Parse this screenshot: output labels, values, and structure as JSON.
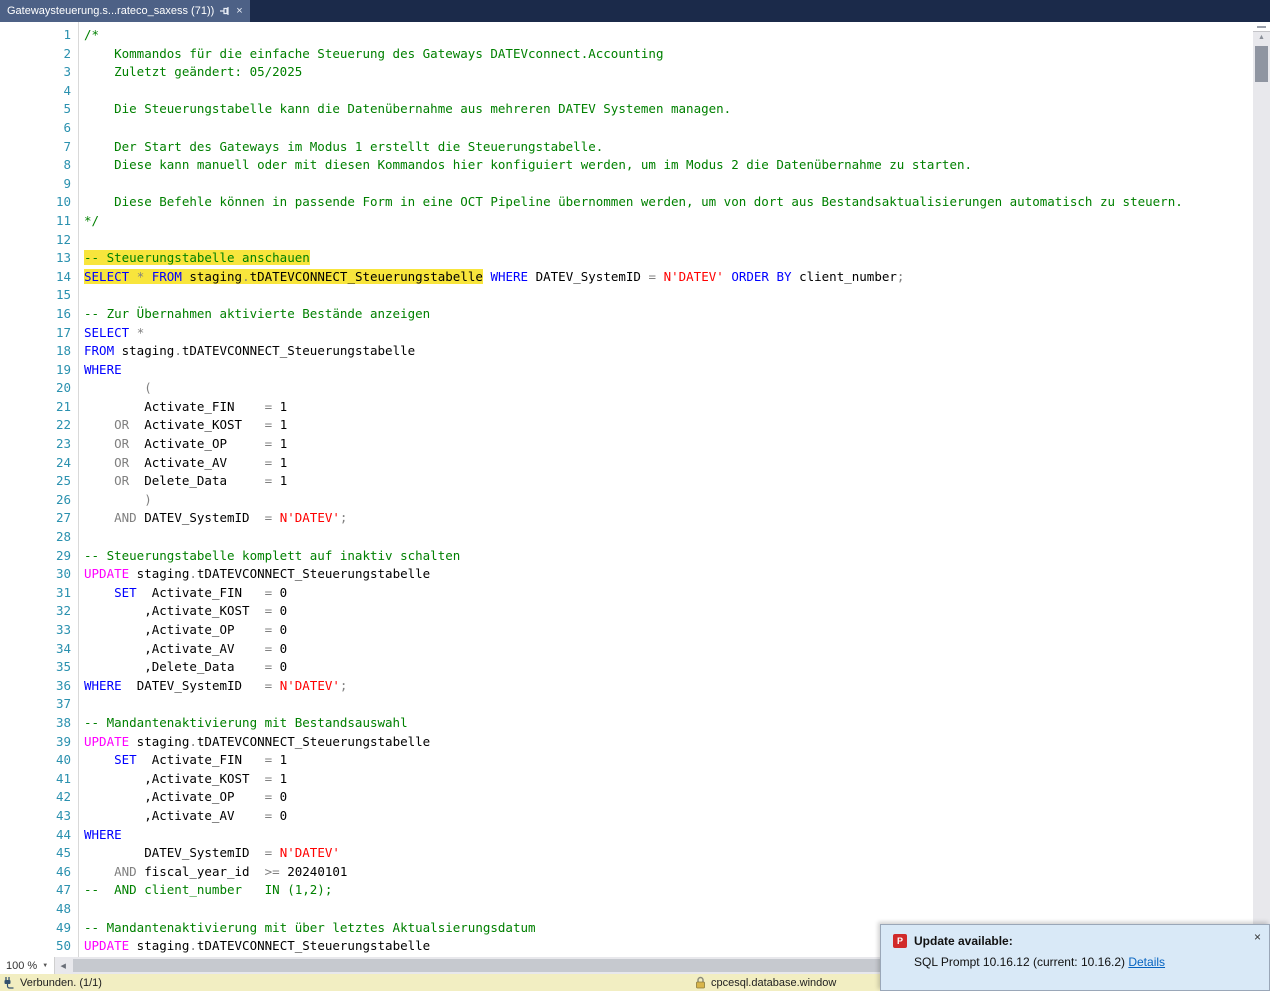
{
  "tab": {
    "title": "Gatewaysteuerung.s...rateco_saxess (71))"
  },
  "zoom": {
    "value": "100 %"
  },
  "status": {
    "connection": "Verbunden. (1/1)",
    "server": "cpcesql.database.window"
  },
  "notification": {
    "title": "Update available:",
    "message": "SQL Prompt 10.16.12 (current: 10.16.2) ",
    "link": "Details",
    "close": "×",
    "icon_label": "P"
  },
  "colors": {
    "kw": "#0000ff",
    "cm": "#008000",
    "st": "#ff0000",
    "op": "#808080",
    "mg": "#ff00ff",
    "tx": "#000000",
    "lnc": "#2b91af",
    "hl": "#f8e53c",
    "tabbg": "#1b2a4a",
    "tabactive": "#4d6186",
    "statusbg": "#f2eec2",
    "notifbg": "#d9e9f7",
    "link": "#0563c1"
  },
  "editor": {
    "lines": [
      {
        "n": 1,
        "tk": [
          [
            "c",
            "/*"
          ]
        ]
      },
      {
        "n": 2,
        "tk": [
          [
            "c",
            "    Kommandos für die einfache Steuerung des Gateways DATEVconnect.Accounting"
          ]
        ]
      },
      {
        "n": 3,
        "tk": [
          [
            "c",
            "    Zuletzt geändert: 05/2025"
          ]
        ]
      },
      {
        "n": 4,
        "tk": []
      },
      {
        "n": 5,
        "tk": [
          [
            "c",
            "    Die Steuerungstabelle kann die Datenübernahme aus mehreren DATEV Systemen managen."
          ]
        ]
      },
      {
        "n": 6,
        "tk": []
      },
      {
        "n": 7,
        "tk": [
          [
            "c",
            "    Der Start des Gateways im Modus 1 erstellt die Steuerungstabelle."
          ]
        ]
      },
      {
        "n": 8,
        "tk": [
          [
            "c",
            "    Diese kann manuell oder mit diesen Kommandos hier konfiguiert werden, um im Modus 2 die Datenübernahme zu starten."
          ]
        ]
      },
      {
        "n": 9,
        "tk": []
      },
      {
        "n": 10,
        "tk": [
          [
            "c",
            "    Diese Befehle können in passende Form in eine OCT Pipeline übernommen werden, um von dort aus Bestandsaktualisierungen automatisch zu steuern."
          ]
        ]
      },
      {
        "n": 11,
        "tk": [
          [
            "c",
            "*/"
          ]
        ]
      },
      {
        "n": 12,
        "tk": []
      },
      {
        "n": 13,
        "tk": [
          [
            "c",
            "-- Steuerungstabelle anschauen",
            1
          ]
        ]
      },
      {
        "n": 14,
        "tk": [
          [
            "k",
            "SELECT",
            1
          ],
          [
            "t",
            " ",
            1
          ],
          [
            "o",
            "*",
            1
          ],
          [
            "t",
            " ",
            1
          ],
          [
            "k",
            "FROM",
            1
          ],
          [
            "t",
            " staging",
            1
          ],
          [
            "o",
            ".",
            1
          ],
          [
            "t",
            "tDATEVCONNECT_Steuerungstabelle",
            1
          ],
          [
            "t",
            " "
          ],
          [
            "k",
            "WHERE"
          ],
          [
            "t",
            " DATEV_SystemID "
          ],
          [
            "o",
            "="
          ],
          [
            "t",
            " "
          ],
          [
            "s",
            "N'DATEV'"
          ],
          [
            "t",
            " "
          ],
          [
            "k",
            "ORDER"
          ],
          [
            "t",
            " "
          ],
          [
            "k",
            "BY"
          ],
          [
            "t",
            " client_number"
          ],
          [
            "o",
            ";"
          ]
        ]
      },
      {
        "n": 15,
        "tk": []
      },
      {
        "n": 16,
        "tk": [
          [
            "c",
            "-- Zur Übernahmen aktivierte Bestände anzeigen"
          ]
        ]
      },
      {
        "n": 17,
        "tk": [
          [
            "k",
            "SELECT"
          ],
          [
            "t",
            " "
          ],
          [
            "o",
            "*"
          ]
        ]
      },
      {
        "n": 18,
        "tk": [
          [
            "k",
            "FROM"
          ],
          [
            "t",
            " staging"
          ],
          [
            "o",
            "."
          ],
          [
            "t",
            "tDATEVCONNECT_Steuerungstabelle"
          ]
        ]
      },
      {
        "n": 19,
        "tk": [
          [
            "k",
            "WHERE"
          ]
        ]
      },
      {
        "n": 20,
        "tk": [
          [
            "t",
            "        "
          ],
          [
            "o",
            "("
          ]
        ]
      },
      {
        "n": 21,
        "tk": [
          [
            "t",
            "        Activate_FIN    "
          ],
          [
            "o",
            "="
          ],
          [
            "t",
            " 1"
          ]
        ]
      },
      {
        "n": 22,
        "tk": [
          [
            "t",
            "    "
          ],
          [
            "o",
            "OR"
          ],
          [
            "t",
            "  Activate_KOST   "
          ],
          [
            "o",
            "="
          ],
          [
            "t",
            " 1"
          ]
        ]
      },
      {
        "n": 23,
        "tk": [
          [
            "t",
            "    "
          ],
          [
            "o",
            "OR"
          ],
          [
            "t",
            "  Activate_OP     "
          ],
          [
            "o",
            "="
          ],
          [
            "t",
            " 1"
          ]
        ]
      },
      {
        "n": 24,
        "tk": [
          [
            "t",
            "    "
          ],
          [
            "o",
            "OR"
          ],
          [
            "t",
            "  Activate_AV     "
          ],
          [
            "o",
            "="
          ],
          [
            "t",
            " 1"
          ]
        ]
      },
      {
        "n": 25,
        "tk": [
          [
            "t",
            "    "
          ],
          [
            "o",
            "OR"
          ],
          [
            "t",
            "  Delete_Data     "
          ],
          [
            "o",
            "="
          ],
          [
            "t",
            " 1"
          ]
        ]
      },
      {
        "n": 26,
        "tk": [
          [
            "t",
            "        "
          ],
          [
            "o",
            ")"
          ]
        ]
      },
      {
        "n": 27,
        "tk": [
          [
            "t",
            "    "
          ],
          [
            "o",
            "AND"
          ],
          [
            "t",
            " DATEV_SystemID  "
          ],
          [
            "o",
            "="
          ],
          [
            "t",
            " "
          ],
          [
            "s",
            "N'DATEV'"
          ],
          [
            "o",
            ";"
          ]
        ]
      },
      {
        "n": 28,
        "tk": []
      },
      {
        "n": 29,
        "tk": [
          [
            "c",
            "-- Steuerungstabelle komplett auf inaktiv schalten"
          ]
        ]
      },
      {
        "n": 30,
        "tk": [
          [
            "m",
            "UPDATE"
          ],
          [
            "t",
            " staging"
          ],
          [
            "o",
            "."
          ],
          [
            "t",
            "tDATEVCONNECT_Steuerungstabelle"
          ]
        ]
      },
      {
        "n": 31,
        "tk": [
          [
            "t",
            "    "
          ],
          [
            "k",
            "SET"
          ],
          [
            "t",
            "  Activate_FIN   "
          ],
          [
            "o",
            "="
          ],
          [
            "t",
            " 0"
          ]
        ]
      },
      {
        "n": 32,
        "tk": [
          [
            "t",
            "        ,Activate_KOST  "
          ],
          [
            "o",
            "="
          ],
          [
            "t",
            " 0"
          ]
        ]
      },
      {
        "n": 33,
        "tk": [
          [
            "t",
            "        ,Activate_OP    "
          ],
          [
            "o",
            "="
          ],
          [
            "t",
            " 0"
          ]
        ]
      },
      {
        "n": 34,
        "tk": [
          [
            "t",
            "        ,Activate_AV    "
          ],
          [
            "o",
            "="
          ],
          [
            "t",
            " 0"
          ]
        ]
      },
      {
        "n": 35,
        "tk": [
          [
            "t",
            "        ,Delete_Data    "
          ],
          [
            "o",
            "="
          ],
          [
            "t",
            " 0"
          ]
        ]
      },
      {
        "n": 36,
        "tk": [
          [
            "k",
            "WHERE"
          ],
          [
            "t",
            "  DATEV_SystemID   "
          ],
          [
            "o",
            "="
          ],
          [
            "t",
            " "
          ],
          [
            "s",
            "N'DATEV'"
          ],
          [
            "o",
            ";"
          ]
        ]
      },
      {
        "n": 37,
        "tk": []
      },
      {
        "n": 38,
        "tk": [
          [
            "c",
            "-- Mandantenaktivierung mit Bestandsauswahl"
          ]
        ]
      },
      {
        "n": 39,
        "tk": [
          [
            "m",
            "UPDATE"
          ],
          [
            "t",
            " staging"
          ],
          [
            "o",
            "."
          ],
          [
            "t",
            "tDATEVCONNECT_Steuerungstabelle"
          ]
        ]
      },
      {
        "n": 40,
        "tk": [
          [
            "t",
            "    "
          ],
          [
            "k",
            "SET"
          ],
          [
            "t",
            "  Activate_FIN   "
          ],
          [
            "o",
            "="
          ],
          [
            "t",
            " 1"
          ]
        ]
      },
      {
        "n": 41,
        "tk": [
          [
            "t",
            "        ,Activate_KOST  "
          ],
          [
            "o",
            "="
          ],
          [
            "t",
            " 1"
          ]
        ]
      },
      {
        "n": 42,
        "tk": [
          [
            "t",
            "        ,Activate_OP    "
          ],
          [
            "o",
            "="
          ],
          [
            "t",
            " 0"
          ]
        ]
      },
      {
        "n": 43,
        "tk": [
          [
            "t",
            "        ,Activate_AV    "
          ],
          [
            "o",
            "="
          ],
          [
            "t",
            " 0"
          ]
        ]
      },
      {
        "n": 44,
        "tk": [
          [
            "k",
            "WHERE"
          ]
        ]
      },
      {
        "n": 45,
        "tk": [
          [
            "t",
            "        DATEV_SystemID  "
          ],
          [
            "o",
            "="
          ],
          [
            "t",
            " "
          ],
          [
            "s",
            "N'DATEV'"
          ]
        ]
      },
      {
        "n": 46,
        "tk": [
          [
            "t",
            "    "
          ],
          [
            "o",
            "AND"
          ],
          [
            "t",
            " fiscal_year_id  "
          ],
          [
            "o",
            ">="
          ],
          [
            "t",
            " 20240101"
          ]
        ]
      },
      {
        "n": 47,
        "tk": [
          [
            "c",
            "--  AND client_number   IN (1,2);"
          ]
        ]
      },
      {
        "n": 48,
        "tk": []
      },
      {
        "n": 49,
        "tk": [
          [
            "c",
            "-- Mandantenaktivierung mit über letztes Aktualsierungsdatum"
          ]
        ]
      },
      {
        "n": 50,
        "tk": [
          [
            "m",
            "UPDATE"
          ],
          [
            "t",
            " staging"
          ],
          [
            "o",
            "."
          ],
          [
            "t",
            "tDATEVCONNECT_Steuerungstabelle"
          ]
        ]
      }
    ]
  }
}
